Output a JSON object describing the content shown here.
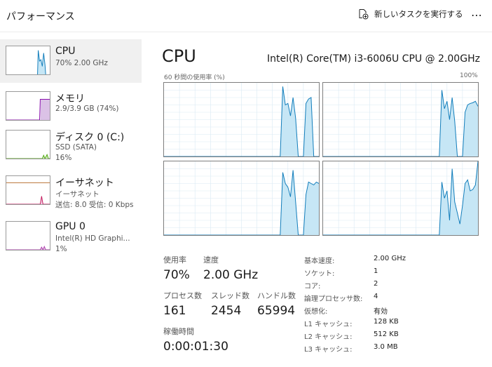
{
  "header": {
    "title": "パフォーマンス",
    "new_task_label": "新しいタスクを実行する",
    "new_task_icon": "run-task-icon",
    "more_label": "⋯"
  },
  "sidebar": {
    "items": [
      {
        "name": "CPU",
        "sub1": "70%  2.00 GHz",
        "sub2": "",
        "selected": true,
        "graph_color": "#117dbb"
      },
      {
        "name": "メモリ",
        "sub1": "2.9/3.9 GB (74%)",
        "sub2": "",
        "selected": false,
        "graph_color": "#8b12ae"
      },
      {
        "name": "ディスク 0 (C:)",
        "sub1": "SSD (SATA)",
        "sub2": "16%",
        "selected": false,
        "graph_color": "#4da60c"
      },
      {
        "name": "イーサネット",
        "sub1": "イーサネット",
        "sub2": "送信: 8.0  受信: 0 Kbps",
        "selected": false,
        "graph_color": "#a74f01"
      },
      {
        "name": "GPU 0",
        "sub1": "Intel(R) HD Graphi...",
        "sub2": "1%",
        "selected": false,
        "graph_color": "#ac39ac"
      }
    ]
  },
  "main": {
    "title": "CPU",
    "model": "Intel(R) Core(TM) i3-6006U CPU @ 2.00GHz",
    "util_label": "60 秒間の使用率 (%)",
    "max_label": "100%",
    "graph_line_color": "#117dbb",
    "graph_fill_color": "#c6e6f5",
    "graph_grid_color": "#d9eaf4"
  },
  "chart_data": {
    "type": "area",
    "x_range": [
      0,
      60
    ],
    "ylim": [
      0,
      100
    ],
    "series": [
      {
        "x": [
          0,
          45,
          46,
          47,
          48,
          49,
          50,
          51,
          52,
          53,
          54,
          55,
          56,
          57,
          58,
          59,
          60
        ],
        "values": [
          0,
          0,
          95,
          70,
          72,
          55,
          80,
          52,
          0,
          0,
          0,
          72,
          78,
          80,
          0,
          0,
          0
        ]
      },
      {
        "x": [
          0,
          45,
          46,
          47,
          48,
          49,
          50,
          51,
          52,
          53,
          54,
          55,
          56,
          57,
          58,
          59,
          60
        ],
        "values": [
          0,
          0,
          90,
          65,
          75,
          50,
          80,
          48,
          0,
          0,
          0,
          60,
          70,
          72,
          73,
          75,
          68
        ]
      },
      {
        "x": [
          0,
          45,
          46,
          47,
          48,
          49,
          50,
          51,
          52,
          53,
          54,
          55,
          56,
          57,
          58,
          59,
          60
        ],
        "values": [
          0,
          0,
          85,
          70,
          65,
          52,
          88,
          45,
          0,
          0,
          0,
          55,
          72,
          70,
          68,
          72,
          70
        ]
      },
      {
        "x": [
          0,
          45,
          46,
          47,
          48,
          49,
          50,
          51,
          52,
          53,
          54,
          55,
          56,
          57,
          58,
          59,
          60
        ],
        "values": [
          0,
          0,
          72,
          50,
          60,
          20,
          90,
          45,
          30,
          15,
          40,
          70,
          75,
          60,
          62,
          68,
          100
        ]
      }
    ]
  },
  "stats": {
    "usage_label": "使用率",
    "usage_value": "70%",
    "speed_label": "速度",
    "speed_value": "2.00 GHz",
    "processes_label": "プロセス数",
    "processes_value": "161",
    "threads_label": "スレッド数",
    "threads_value": "2454",
    "handles_label": "ハンドル数",
    "handles_value": "65994",
    "uptime_label": "稼働時間",
    "uptime_value": "0:00:01:30"
  },
  "info": [
    {
      "label": "基本速度:",
      "value": "2.00 GHz"
    },
    {
      "label": "ソケット:",
      "value": "1"
    },
    {
      "label": "コア:",
      "value": "2"
    },
    {
      "label": "論理プロセッサ数:",
      "value": "4"
    },
    {
      "label": "仮想化:",
      "value": "有効"
    },
    {
      "label": "L1 キャッシュ:",
      "value": "128 KB"
    },
    {
      "label": "L2 キャッシュ:",
      "value": "512 KB"
    },
    {
      "label": "L3 キャッシュ:",
      "value": "3.0 MB"
    }
  ]
}
